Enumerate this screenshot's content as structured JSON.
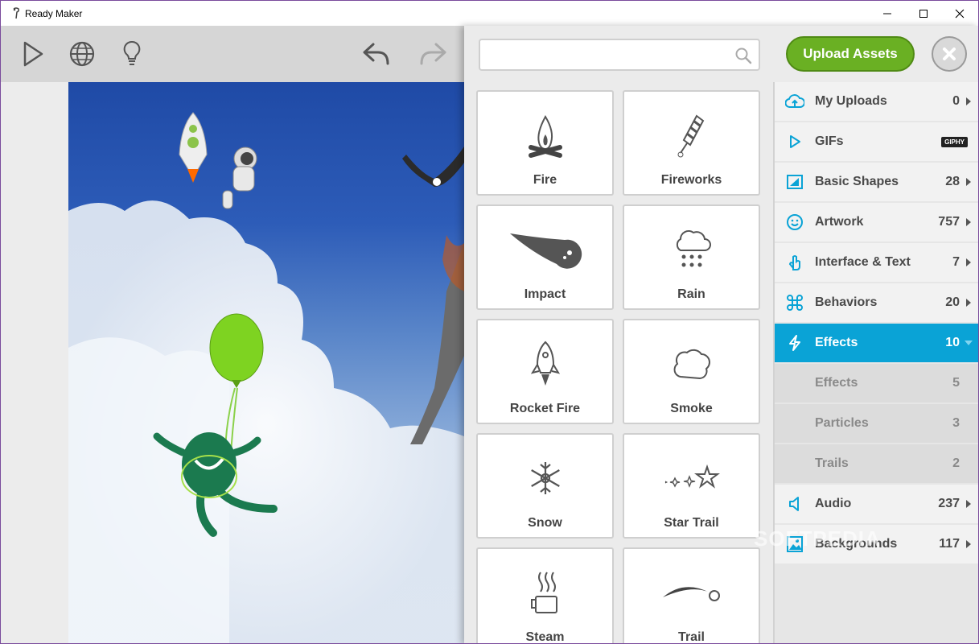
{
  "window": {
    "title": "Ready Maker"
  },
  "toolbar": {
    "play": "play-icon",
    "globe": "globe-icon",
    "hint": "lightbulb-icon",
    "undo": "undo-icon",
    "redo": "redo-icon"
  },
  "search": {
    "placeholder": "",
    "value": ""
  },
  "upload_label": "Upload Assets",
  "colors": {
    "accent": "#0aa3d6",
    "upload": "#6ab023",
    "panel": "#ebebeb"
  },
  "tiles": [
    {
      "label": "Fire",
      "icon": "campfire-icon"
    },
    {
      "label": "Fireworks",
      "icon": "firework-rocket-icon"
    },
    {
      "label": "Impact",
      "icon": "meteor-icon"
    },
    {
      "label": "Rain",
      "icon": "rain-cloud-icon"
    },
    {
      "label": "Rocket Fire",
      "icon": "rocket-icon"
    },
    {
      "label": "Smoke",
      "icon": "smoke-cloud-icon"
    },
    {
      "label": "Snow",
      "icon": "snowflake-icon"
    },
    {
      "label": "Star Trail",
      "icon": "star-trail-icon"
    },
    {
      "label": "Steam",
      "icon": "steaming-mug-icon"
    },
    {
      "label": "Trail",
      "icon": "trail-icon"
    }
  ],
  "categories": [
    {
      "name": "My Uploads",
      "count": "0",
      "icon": "cloud-upload-icon"
    },
    {
      "name": "GIFs",
      "count": "",
      "icon": "play-outline-icon",
      "badge": "GIPHY"
    },
    {
      "name": "Basic Shapes",
      "count": "28",
      "icon": "shapes-icon"
    },
    {
      "name": "Artwork",
      "count": "757",
      "icon": "smiley-icon"
    },
    {
      "name": "Interface & Text",
      "count": "7",
      "icon": "hand-pointer-icon"
    },
    {
      "name": "Behaviors",
      "count": "20",
      "icon": "command-icon"
    },
    {
      "name": "Effects",
      "count": "10",
      "icon": "lightning-icon"
    },
    {
      "name": "Audio",
      "count": "237",
      "icon": "speaker-icon"
    },
    {
      "name": "Backgrounds",
      "count": "117",
      "icon": "landscape-icon"
    }
  ],
  "subcategories": [
    {
      "name": "Effects",
      "count": "5"
    },
    {
      "name": "Particles",
      "count": "3"
    },
    {
      "name": "Trails",
      "count": "2"
    }
  ],
  "watermark": "SOFTPEDIA"
}
